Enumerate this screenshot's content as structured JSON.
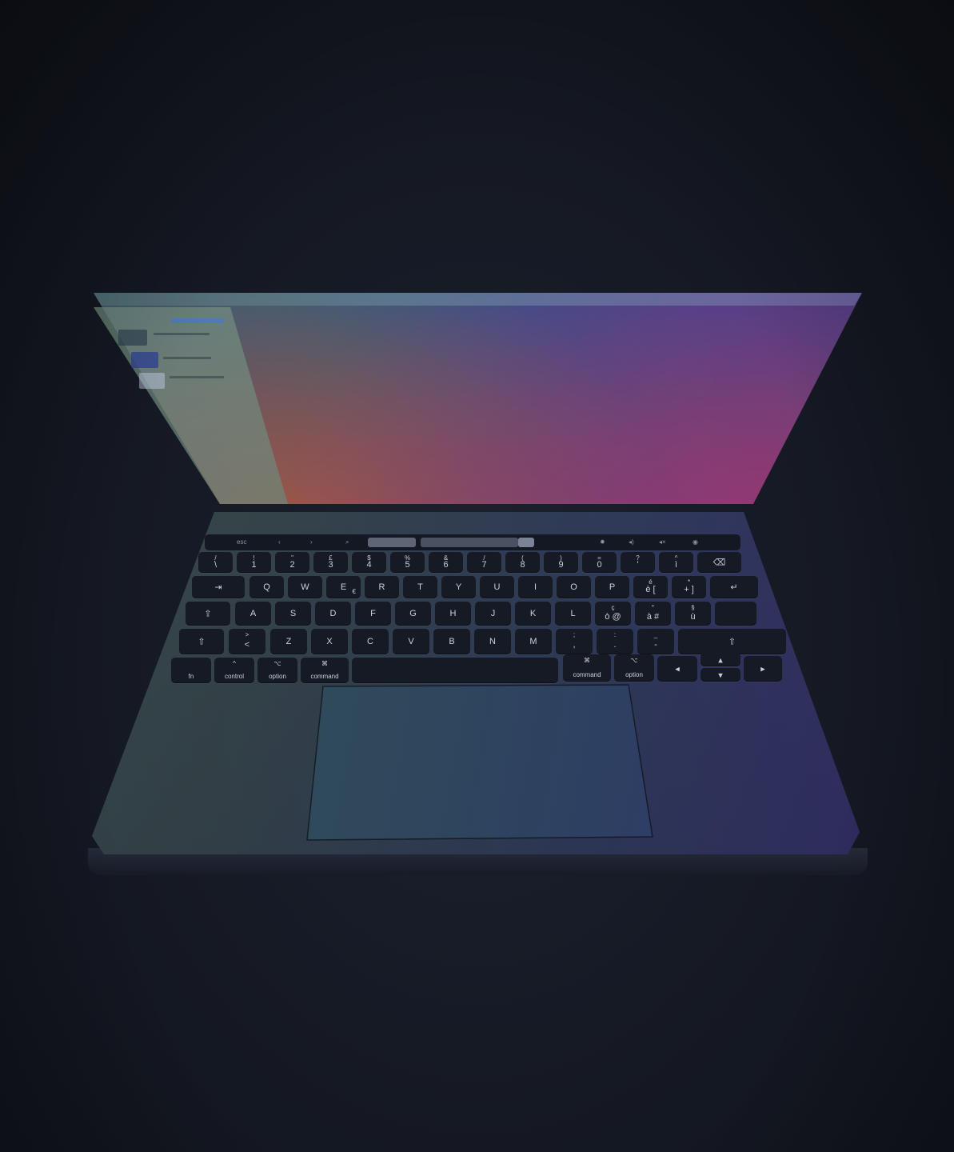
{
  "image": {
    "kind": "photo",
    "subject": "laptop",
    "colors": {
      "background": "#161a25",
      "screen_teal": "#2c8a80",
      "screen_blue": "#4a3cc8",
      "screen_magenta": "#c63e8c",
      "deck": "#354449",
      "key": "#161a24"
    }
  },
  "touch_bar": {
    "esc": "esc",
    "icons": [
      "chevron-left-icon",
      "chevron-right-icon",
      "search-icon",
      "brightness-icon",
      "volume-icon",
      "mute-icon",
      "siri-icon"
    ]
  },
  "keyboard": {
    "number_row": [
      {
        "top": "/",
        "main": "\\"
      },
      {
        "top": "!",
        "main": "1"
      },
      {
        "top": "\"",
        "main": "2"
      },
      {
        "top": "£",
        "main": "3"
      },
      {
        "top": "$",
        "main": "4"
      },
      {
        "top": "%",
        "main": "5"
      },
      {
        "top": "&",
        "main": "6"
      },
      {
        "top": "/",
        "main": "7"
      },
      {
        "top": "(",
        "main": "8"
      },
      {
        "top": ")",
        "main": "9"
      },
      {
        "top": "=",
        "main": "0"
      },
      {
        "top": "?",
        "main": "'"
      },
      {
        "top": "^",
        "main": "ì"
      }
    ],
    "row_q": [
      "Q",
      "W",
      "E",
      "R",
      "T",
      "Y",
      "U",
      "I",
      "O",
      "P"
    ],
    "row_q_extra": [
      {
        "top": "é",
        "main": "è ["
      },
      {
        "top": "*",
        "main": "+ ]"
      }
    ],
    "row_a": [
      "A",
      "S",
      "D",
      "F",
      "G",
      "H",
      "J",
      "K",
      "L"
    ],
    "row_a_extra": [
      {
        "top": "ç",
        "main": "ò @"
      },
      {
        "top": "°",
        "main": "à #"
      },
      {
        "top": "§",
        "main": "ù"
      }
    ],
    "row_z": [
      "Z",
      "X",
      "C",
      "V",
      "B",
      "N",
      "M"
    ],
    "row_z_lt": {
      "top": ">",
      "main": "<"
    },
    "row_z_extra": [
      {
        "top": ";",
        "main": ","
      },
      {
        "top": ":",
        "main": "."
      },
      {
        "top": "_",
        "main": "-"
      }
    ],
    "e_alt": "€",
    "bottom_left": [
      {
        "top": "",
        "main": "fn"
      },
      {
        "top": "^",
        "main": "control"
      },
      {
        "top": "⌥",
        "main": "option"
      },
      {
        "top": "⌘",
        "main": "command"
      }
    ],
    "bottom_right": [
      {
        "top": "⌘",
        "main": "command"
      },
      {
        "top": "⌥",
        "main": "option"
      }
    ]
  }
}
